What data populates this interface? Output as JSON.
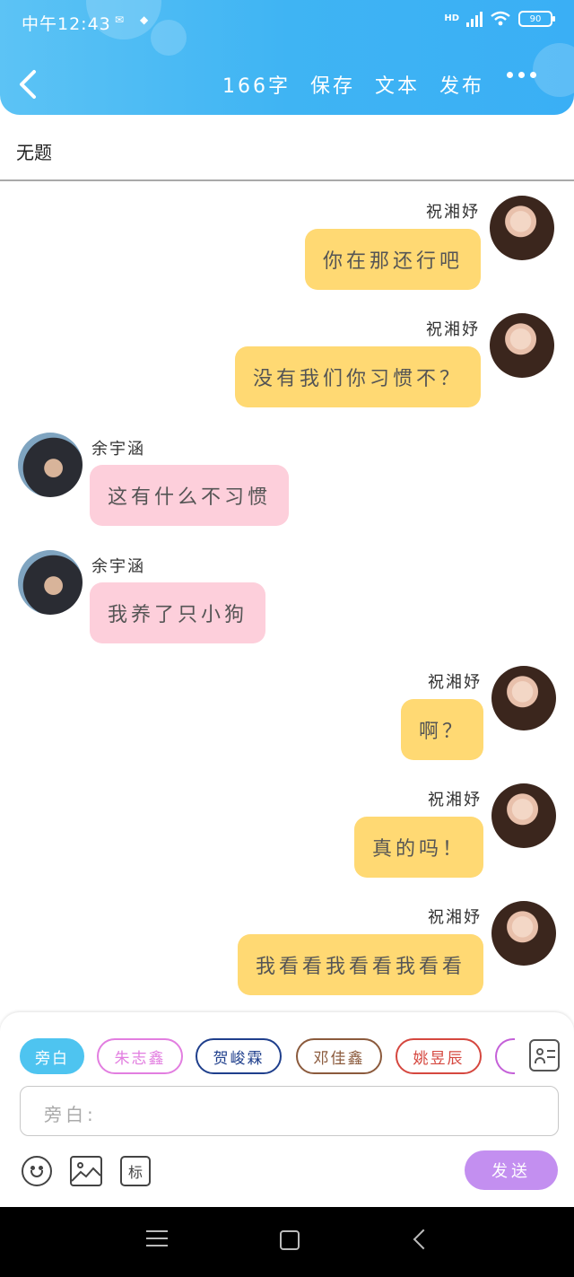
{
  "status_bar": {
    "time": "中午12:43",
    "network": "HD",
    "battery": "90"
  },
  "header": {
    "back_icon": "chevron-left-icon",
    "word_count": "166字",
    "save_label": "保存",
    "text_label": "文本",
    "publish_label": "发布",
    "more_icon": "more-dots-icon"
  },
  "document": {
    "title": "无题"
  },
  "messages": [
    {
      "side": "right",
      "speaker": "祝湘妤",
      "text": "你在那还行吧"
    },
    {
      "side": "right",
      "speaker": "祝湘妤",
      "text": "没有我们你习惯不？"
    },
    {
      "side": "left",
      "speaker": "余宇涵",
      "text": "这有什么不习惯"
    },
    {
      "side": "left",
      "speaker": "余宇涵",
      "text": "我养了只小狗"
    },
    {
      "side": "right",
      "speaker": "祝湘妤",
      "text": "啊？"
    },
    {
      "side": "right",
      "speaker": "祝湘妤",
      "text": "真的吗！"
    },
    {
      "side": "right",
      "speaker": "祝湘妤",
      "text": "我看看我看看我看看"
    }
  ],
  "role_chips": [
    {
      "label": "旁白",
      "color": "#4ec4f0",
      "active": true
    },
    {
      "label": "朱志鑫",
      "color": "#e27ee0",
      "active": false
    },
    {
      "label": "贺峻霖",
      "color": "#1f3f8c",
      "active": false
    },
    {
      "label": "邓佳鑫",
      "color": "#8b5a3c",
      "active": false
    },
    {
      "label": "姚昱辰",
      "color": "#d5473f",
      "active": false
    },
    {
      "label": "",
      "color": "#c460d8",
      "active": false
    }
  ],
  "composer": {
    "placeholder": "旁白:",
    "emoji_icon": "emoji-icon",
    "image_icon": "image-icon",
    "mark_label": "标",
    "send_label": "发送",
    "contacts_icon": "contacts-icon"
  },
  "colors": {
    "header_blue": "#3fb4f3",
    "right_bubble": "#ffd973",
    "left_bubble": "#fdcfdb",
    "send_button": "#c38ff0"
  }
}
